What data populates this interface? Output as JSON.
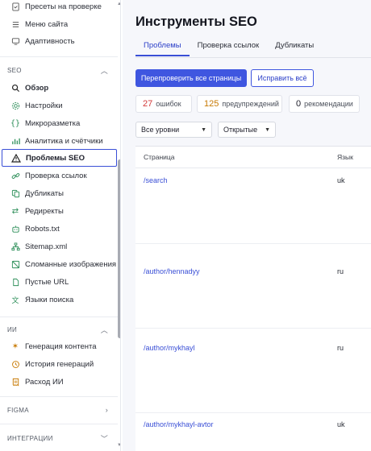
{
  "sidebar": {
    "top_items": [
      {
        "label": "Пресеты на проверке",
        "icon": "document-check-icon"
      },
      {
        "label": "Меню сайта",
        "icon": "menu-lines-icon"
      },
      {
        "label": "Адаптивность",
        "icon": "monitor-icon"
      }
    ],
    "seo_section": {
      "title": "SEO",
      "items": [
        {
          "label": "Обзор",
          "icon": "search-icon",
          "bold": true
        },
        {
          "label": "Настройки",
          "icon": "gear-icon"
        },
        {
          "label": "Микроразметка",
          "icon": "braces-icon"
        },
        {
          "label": "Аналитика и счётчики",
          "icon": "bar-chart-icon"
        },
        {
          "label": "Проблемы SEO",
          "icon": "warning-triangle-icon",
          "active": true
        },
        {
          "label": "Проверка ссылок",
          "icon": "link-icon"
        },
        {
          "label": "Дубликаты",
          "icon": "copy-icon"
        },
        {
          "label": "Редиректы",
          "icon": "arrows-swap-icon"
        },
        {
          "label": "Robots.txt",
          "icon": "robot-icon"
        },
        {
          "label": "Sitemap.xml",
          "icon": "sitemap-icon"
        },
        {
          "label": "Сломанные изображения",
          "icon": "broken-image-icon"
        },
        {
          "label": "Пустые URL",
          "icon": "empty-page-icon"
        },
        {
          "label": "Языки поиска",
          "icon": "translate-icon"
        }
      ]
    },
    "ai_section": {
      "title": "ИИ",
      "items": [
        {
          "label": "Генерация контента",
          "icon": "sparkle-icon"
        },
        {
          "label": "История генераций",
          "icon": "history-icon"
        },
        {
          "label": "Расход ИИ",
          "icon": "receipt-icon"
        }
      ]
    },
    "figma_section": {
      "title": "FIGMA"
    },
    "integrations_section": {
      "title": "ИНТЕГРАЦИИ"
    }
  },
  "main": {
    "title": "Инструменты SEO",
    "tabs": [
      {
        "label": "Проблемы",
        "active": true
      },
      {
        "label": "Проверка ссылок"
      },
      {
        "label": "Дубликаты"
      }
    ],
    "buttons": {
      "recheck": "Перепроверить все страницы",
      "fix_all": "Исправить всё"
    },
    "stats": {
      "errors": {
        "count": "27",
        "label": "ошибок"
      },
      "warnings": {
        "count": "125",
        "label": "предупреждений"
      },
      "recommendations": {
        "count": "0",
        "label": "рекомендации"
      }
    },
    "filters": {
      "level": "Все уровни",
      "status": "Открытые"
    },
    "table": {
      "columns": [
        "Страница",
        "Язык"
      ],
      "rows": [
        {
          "page": "/search",
          "lang": "uk"
        },
        {
          "page": "/author/hennadyy",
          "lang": "ru"
        },
        {
          "page": "/author/mykhayl",
          "lang": "ru"
        },
        {
          "page": "/author/mykhayl-avtor",
          "lang": "uk"
        }
      ]
    }
  },
  "colors": {
    "accent": "#3f56e0",
    "error": "#d43a3a",
    "warning": "#c77800"
  }
}
